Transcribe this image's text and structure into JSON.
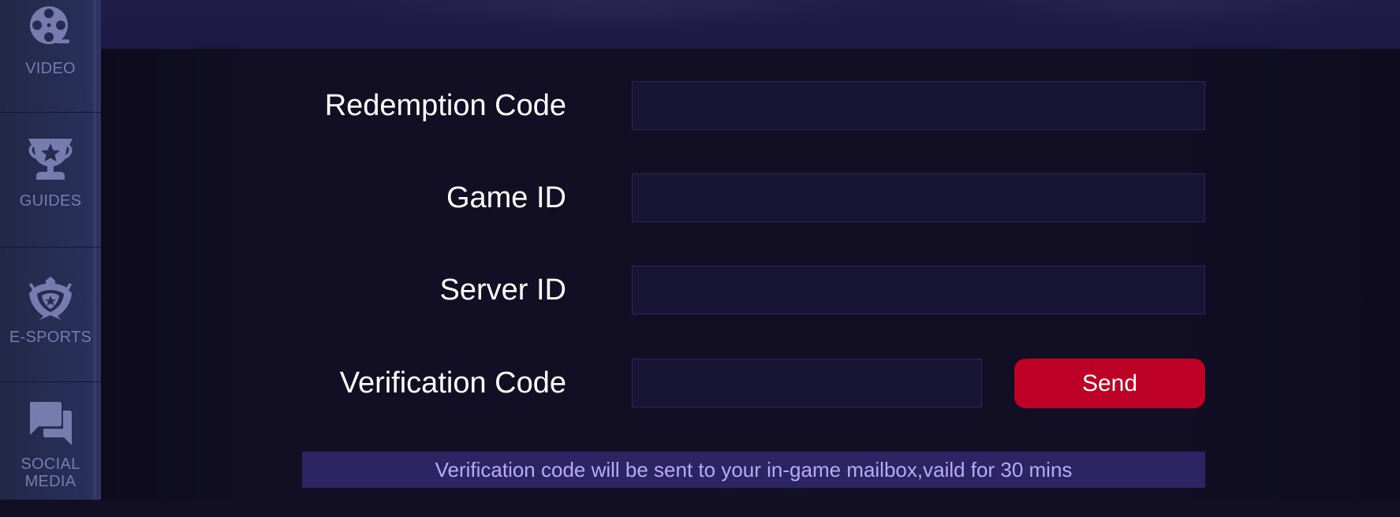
{
  "sidebar": {
    "items": [
      {
        "label": "VIDEO",
        "icon": "film-reel-icon"
      },
      {
        "label": "GUIDES",
        "icon": "trophy-icon"
      },
      {
        "label": "E-SPORTS",
        "icon": "crest-shield-icon"
      },
      {
        "label": "SOCIAL MEDIA",
        "icon": "chat-bubbles-icon"
      }
    ]
  },
  "form": {
    "redemption_code": {
      "label": "Redemption Code",
      "value": "",
      "placeholder": ""
    },
    "game_id": {
      "label": "Game ID",
      "value": "",
      "placeholder": ""
    },
    "server_id": {
      "label": "Server ID",
      "value": "",
      "placeholder": ""
    },
    "verification_code": {
      "label": "Verification Code",
      "value": "",
      "placeholder": ""
    },
    "send_label": "Send",
    "notice": "Verification code will be sent to your in-game mailbox,vaild for 30 mins"
  },
  "colors": {
    "send_button": "#bd0026",
    "notice_bg": "#2c2463",
    "notice_text": "#b8aaf6",
    "sidebar_icon": "#767cae",
    "page_bg": "#120f24"
  }
}
